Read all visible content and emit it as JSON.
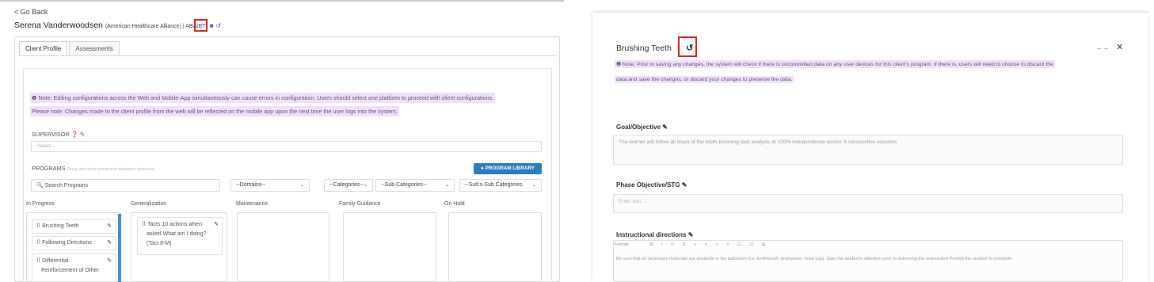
{
  "left": {
    "back_label": "< Go Back",
    "client_name": "Serena Vanderwoodsen",
    "client_meta": "(American Healthcare Alliance) | ABA(BT)",
    "tabs": [
      {
        "label": "Client Profile",
        "active": true
      },
      {
        "label": "Assessments",
        "active": false
      }
    ],
    "note_line1": "❶ Note: Editing configurations across the Web and Mobile-App simultaneously can cause errors in configuration. Users should select one platform to proceed with client configurations.",
    "note_line2": "Please note: Changes made to the client profile from the web will be reflected on the mobile app upon the next time the user logs into the system.",
    "supervisor_label": "SUPERVISOR",
    "supervisor_placeholder": "--Select--",
    "programs_label": "PROGRAMS",
    "programs_hint": "Drag and drop programs between statuses",
    "program_library_button": "PROGRAM LIBRARY",
    "search_placeholder": "Search Programs",
    "filters": [
      "--Domains--",
      "--Categories--",
      "--Sub Categories--",
      "--Sub's-Sub Categories"
    ],
    "columns": [
      "In Progress",
      "Generalization",
      "Maintenance",
      "Family Guidance",
      "On Hold"
    ],
    "in_progress": [
      "Brushing Teeth",
      "Following Directions",
      "Differential",
      "Reinforcement of Other"
    ],
    "generalization": [
      "Tacts 10 actions when",
      "asked What am I doing?",
      "(Tact 8-M)"
    ]
  },
  "right": {
    "title": "Brushing Teeth",
    "note_line1": "❶ Note: Prior to saving any changes, the system will check if there is uncommitted data on any user devices for this client's program. If there is, users will need to choose to discard the",
    "note_line2": "data and save the changes, or discard your changes to preserve the data.",
    "goal_label": "Goal/Objective",
    "goal_text": "The learner will follow all steps of the tooth-brushing task analysis at 100% independence across 3 consecutive sessions",
    "phase_label": "Phase Objective/STG",
    "phase_placeholder": "Enter text...",
    "instr_label": "Instructional directions",
    "toolbar_items": [
      "Format",
      "B",
      "I",
      "U",
      "S",
      "≡",
      "≡",
      "≡",
      "≡",
      "☷",
      "☷",
      "⊞"
    ],
    "instr_text": "Be sure that all necessary materials are available in the bathroom (i.e. toothbrush, toothpaste, rinse cup). Gain the student's attention prior to delivering the antecedent Prompt the student to complete"
  },
  "colors": {
    "highlight": "#eee1f7",
    "accent_blue": "#2d7cc0",
    "annotation_red": "#e02424"
  }
}
